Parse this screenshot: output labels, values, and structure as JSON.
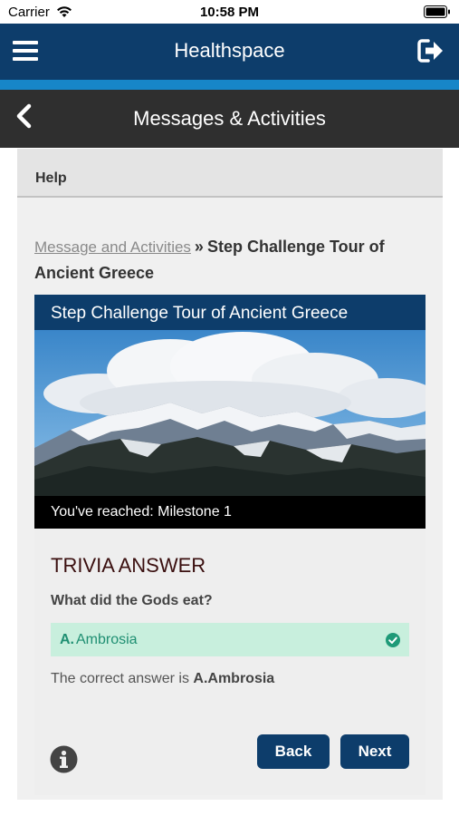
{
  "status_bar": {
    "carrier": "Carrier",
    "time": "10:58 PM"
  },
  "header": {
    "title": "Healthspace"
  },
  "sub_header": {
    "title": "Messages & Activities"
  },
  "help": {
    "label": "Help"
  },
  "breadcrumb": {
    "link": "Message and Activities",
    "separator": "»",
    "current": "Step Challenge Tour of Ancient Greece"
  },
  "card": {
    "title": "Step Challenge Tour of Ancient Greece",
    "milestone": "You've reached: Milestone 1"
  },
  "trivia": {
    "heading": "TRIVIA ANSWER",
    "question": "What did the Gods eat?",
    "answer_letter": "A.",
    "answer_text": "Ambrosia",
    "correct_prefix": "The correct answer is",
    "correct_value": "A.Ambrosia"
  },
  "buttons": {
    "back": "Back",
    "next": "Next"
  },
  "colors": {
    "primary": "#0d3d6b",
    "accent": "#1786c8",
    "success_bg": "#c8efdd",
    "success_text": "#1f8f72"
  },
  "icons": [
    "wifi-icon",
    "battery-icon",
    "menu-icon",
    "logout-icon",
    "back-arrow-icon",
    "check-circle-icon",
    "info-icon"
  ]
}
